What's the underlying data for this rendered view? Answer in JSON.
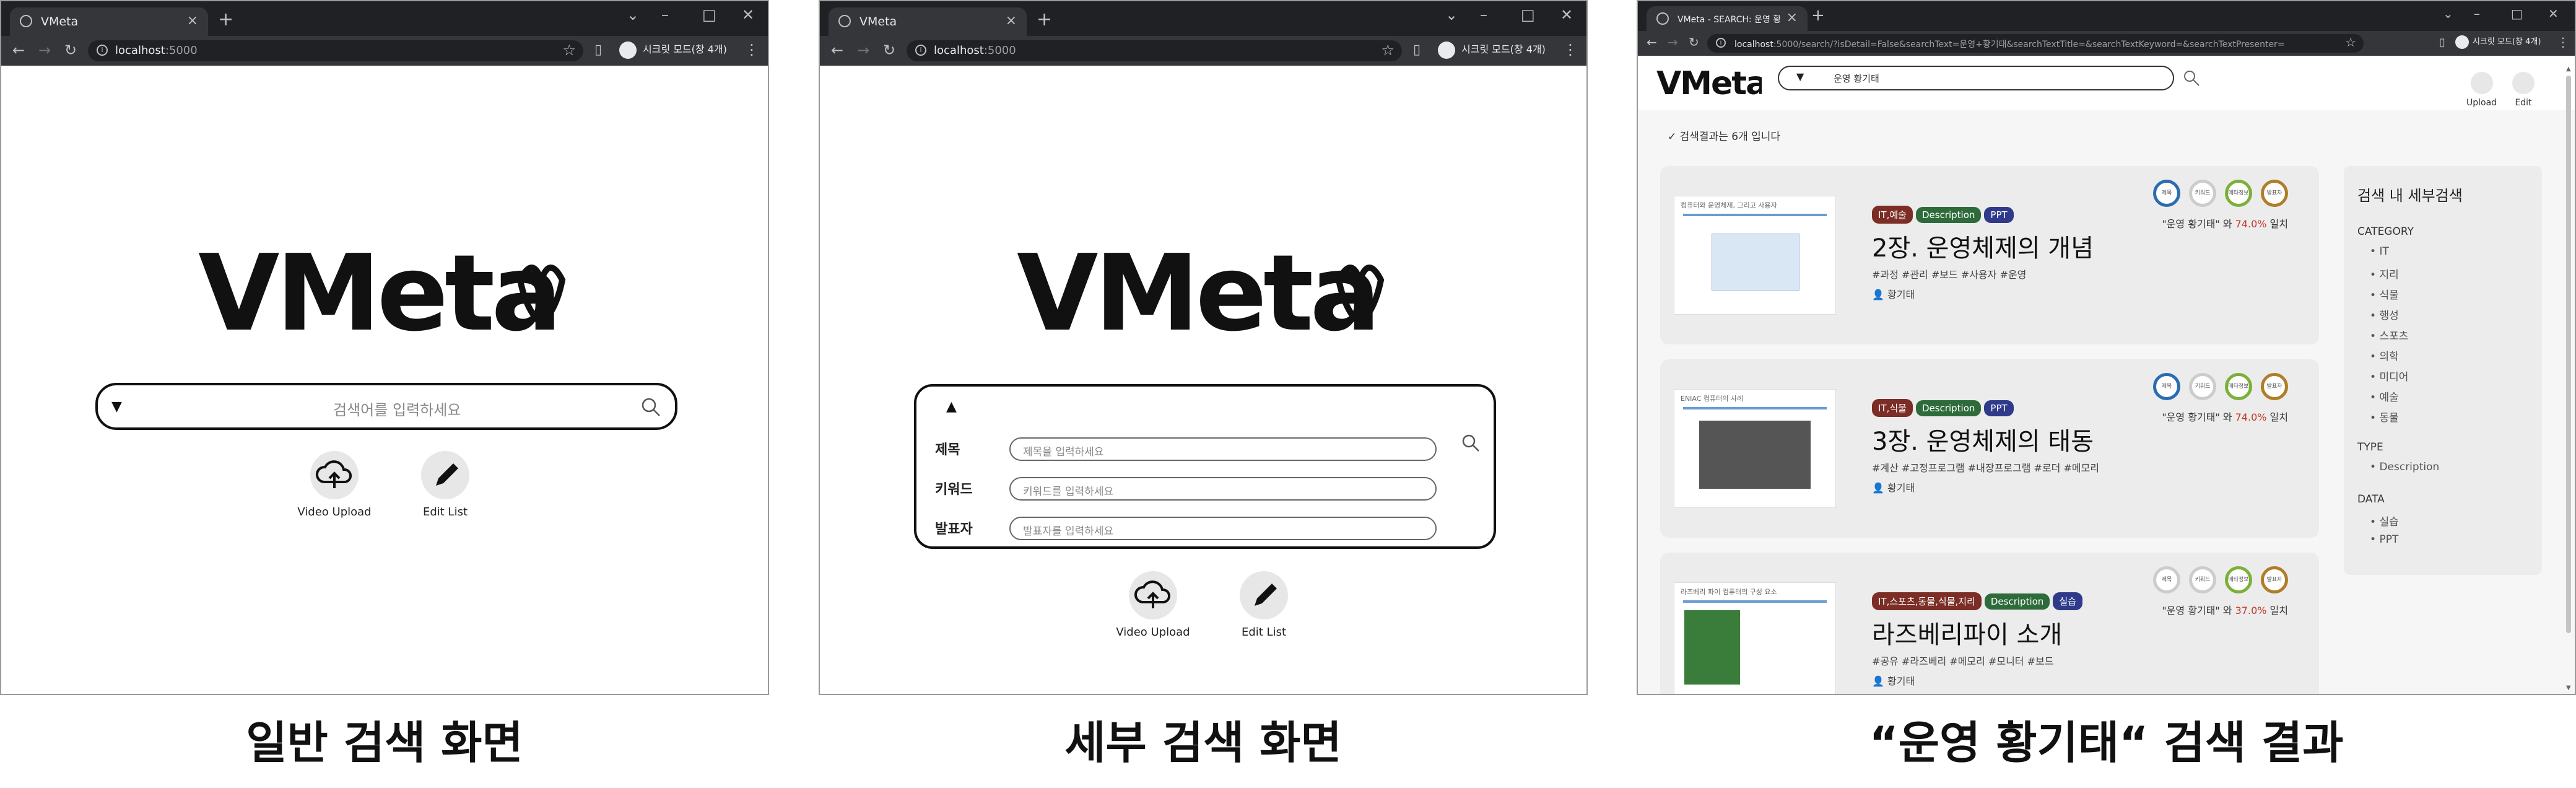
{
  "browser": {
    "tab_title_home": "VMeta",
    "tab_title_result": "VMeta - SEARCH: 운영 황기태",
    "url_host": "localhost",
    "url_port": ":5000",
    "url_result_path": ":5000/search/?isDetail=False&searchText=운영+황기태&searchTextTitle=&searchTextKeyword=&searchTextPresenter=",
    "incognito_label": "시크릿 모드(창 4개)"
  },
  "app": {
    "logo_text": "VMeta",
    "search_placeholder": "검색어를 입력하세요",
    "caret_down": "▼",
    "caret_up": "▲",
    "upload_label": "Video Upload",
    "editlist_label": "Edit List",
    "upload_short": "Upload",
    "edit_short": "Edit"
  },
  "advanced": {
    "fields": [
      {
        "label": "제목",
        "placeholder": "제목을 입력하세요"
      },
      {
        "label": "키워드",
        "placeholder": "키워드를 입력하세요"
      },
      {
        "label": "발표자",
        "placeholder": "발표자를 입력하세요"
      }
    ]
  },
  "results": {
    "query": "운영 황기태",
    "count_text": "✓ 검색결과는 6개 입니다",
    "items": [
      {
        "tags": [
          {
            "text": "IT,예술",
            "color": "#7b2d26"
          },
          {
            "text": "Description",
            "color": "#2e6b3a"
          },
          {
            "text": "PPT",
            "color": "#2f3a8a"
          }
        ],
        "title": "2장. 운영체제의 개념",
        "hashtags": "#과정 #관리 #보드 #사용자 #운영",
        "presenter": "황기태",
        "match_prefix": "\"운영 황기태\" 와",
        "match_value": "74.0%",
        "match_suffix": "일치",
        "thumb_caption": "컴퓨터와 운영체제, 그리고 사용자"
      },
      {
        "tags": [
          {
            "text": "IT,식물",
            "color": "#7b2d26"
          },
          {
            "text": "Description",
            "color": "#2e6b3a"
          },
          {
            "text": "PPT",
            "color": "#2f3a8a"
          }
        ],
        "title": "3장. 운영체제의 태동",
        "hashtags": "#계산 #고정프로그램 #내장프로그램 #로더 #메모리",
        "presenter": "황기태",
        "match_prefix": "\"운영 황기태\" 와",
        "match_value": "74.0%",
        "match_suffix": "일치",
        "thumb_caption": "ENIAC 컴퓨터의 사례"
      },
      {
        "tags": [
          {
            "text": "IT,스포츠,동물,식물,지리",
            "color": "#7b2d26"
          },
          {
            "text": "Description",
            "color": "#2e6b3a"
          },
          {
            "text": "실습",
            "color": "#2f3a8a"
          }
        ],
        "title": "라즈베리파이 소개",
        "hashtags": "#공유 #라즈베리 #메모리 #모니터 #보드",
        "presenter": "황기태",
        "match_prefix": "\"운영 황기태\" 와",
        "match_value": "37.0%",
        "match_suffix": "일치",
        "thumb_caption": "라즈베리 파이 컴퓨터의 구성 요소"
      }
    ],
    "circle_labels": [
      "제목",
      "키워드",
      "메타정보",
      "발표자"
    ]
  },
  "sidebar": {
    "title": "검색 내 세부검색",
    "category_label": "CATEGORY",
    "categories": [
      "IT",
      "지리",
      "식물",
      "행성",
      "스포츠",
      "의학",
      "미디어",
      "예술",
      "동물"
    ],
    "type_label": "TYPE",
    "types": [
      "Description"
    ],
    "data_label": "DATA",
    "datas": [
      "실습",
      "PPT"
    ]
  },
  "captions": {
    "left": "일반 검색 화면",
    "middle": "세부 검색 화면",
    "right": "“운영 황기태“ 검색 결과"
  }
}
